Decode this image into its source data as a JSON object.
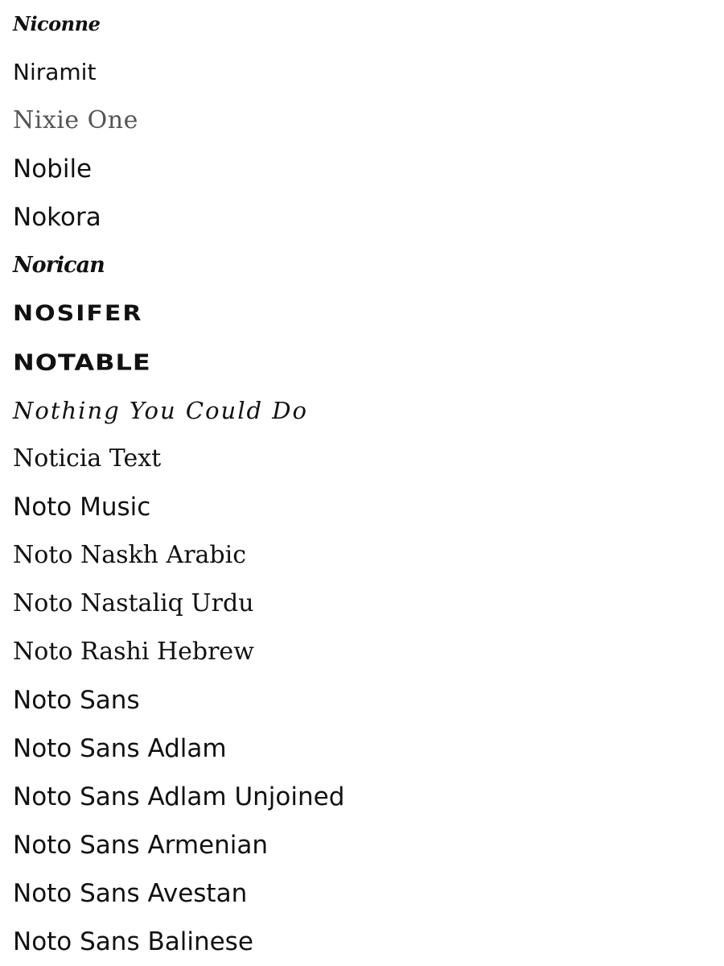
{
  "fonts": [
    {
      "label": "Niconne"
    },
    {
      "label": "Niramit"
    },
    {
      "label": "Nixie One"
    },
    {
      "label": "Nobile"
    },
    {
      "label": "Nokora"
    },
    {
      "label": "Norican"
    },
    {
      "label": "NOSIFER"
    },
    {
      "label": "NOTABLE"
    },
    {
      "label": "Nothing You Could Do"
    },
    {
      "label": "Noticia Text"
    },
    {
      "label": "Noto Music"
    },
    {
      "label": "Noto Naskh Arabic"
    },
    {
      "label": "Noto Nastaliq Urdu"
    },
    {
      "label": "Noto Rashi Hebrew"
    },
    {
      "label": "Noto Sans"
    },
    {
      "label": "Noto Sans Adlam"
    },
    {
      "label": "Noto Sans Adlam Unjoined"
    },
    {
      "label": "Noto Sans Armenian"
    },
    {
      "label": "Noto Sans Avestan"
    },
    {
      "label": "Noto Sans Balinese"
    }
  ]
}
